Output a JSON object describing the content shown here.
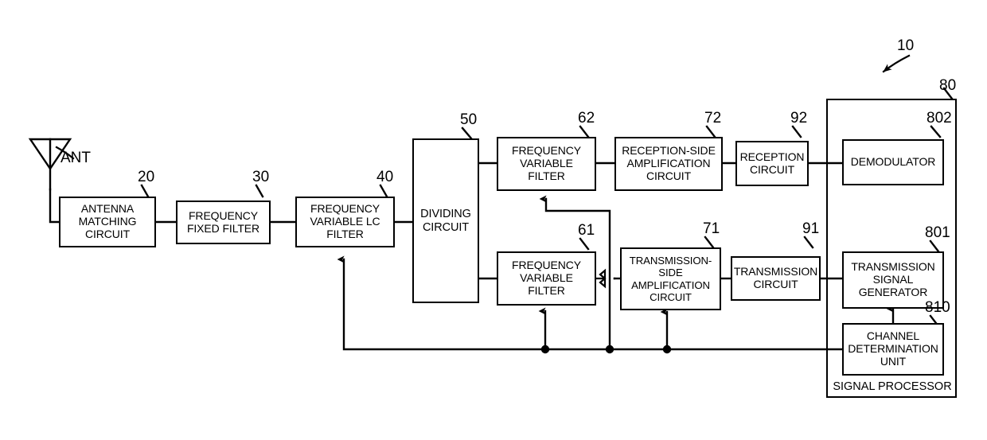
{
  "figure": {
    "system_ref": "10",
    "antenna_label": "ANT"
  },
  "blocks": [
    {
      "id": "antenna_matching",
      "ref": "20",
      "label": "ANTENNA\nMATCHING\nCIRCUIT"
    },
    {
      "id": "freq_fixed_filter",
      "ref": "30",
      "label": "FREQUENCY\nFIXED FILTER"
    },
    {
      "id": "freq_var_lc_filter",
      "ref": "40",
      "label": "FREQUENCY\nVARIABLE LC\nFILTER"
    },
    {
      "id": "dividing_circuit",
      "ref": "50",
      "label": "DIVIDING\nCIRCUIT"
    },
    {
      "id": "rx_freq_var_filter",
      "ref": "62",
      "label": "FREQUENCY\nVARIABLE\nFILTER"
    },
    {
      "id": "rx_amplification",
      "ref": "72",
      "label": "RECEPTION-SIDE\nAMPLIFICATION\nCIRCUIT"
    },
    {
      "id": "reception_circuit",
      "ref": "92",
      "label": "RECEPTION\nCIRCUIT"
    },
    {
      "id": "demodulator",
      "ref": "802",
      "label": "DEMODULATOR"
    },
    {
      "id": "tx_freq_var_filter",
      "ref": "61",
      "label": "FREQUENCY\nVARIABLE\nFILTER"
    },
    {
      "id": "tx_amplification",
      "ref": "71",
      "label": "TRANSMISSION-\nSIDE\nAMPLIFICATION\nCIRCUIT"
    },
    {
      "id": "transmission_circuit",
      "ref": "91",
      "label": "TRANSMISSION\nCIRCUIT"
    },
    {
      "id": "tx_signal_generator",
      "ref": "801",
      "label": "TRANSMISSION\nSIGNAL\nGENERATOR"
    },
    {
      "id": "channel_determination",
      "ref": "810",
      "label": "CHANNEL\nDETERMINATION\nUNIT"
    }
  ],
  "signal_processor": {
    "ref": "80",
    "caption": "SIGNAL PROCESSOR"
  },
  "colors": {
    "line": "#000000",
    "background": "#ffffff",
    "text": "#000000"
  }
}
